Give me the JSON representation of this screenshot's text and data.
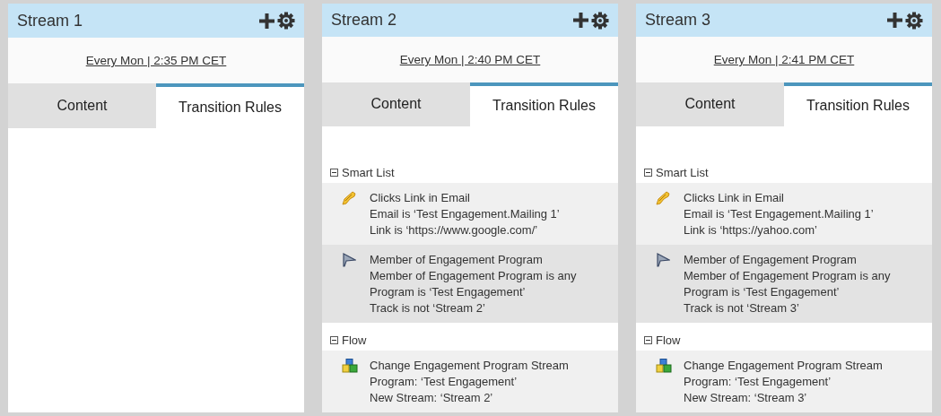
{
  "streams": [
    {
      "title": "Stream 1",
      "schedule": "Every Mon | 2:35 PM CET",
      "tabs": [
        {
          "label": "Content",
          "selected": false
        },
        {
          "label": "Transition Rules",
          "selected": true
        }
      ]
    },
    {
      "title": "Stream 2",
      "schedule": "Every Mon | 2:40 PM CET",
      "tabs": [
        {
          "label": "Content",
          "selected": false
        },
        {
          "label": "Transition Rules",
          "selected": true
        }
      ],
      "sections": [
        {
          "title": "Smart List",
          "expanded": true,
          "items": [
            {
              "kind": "click",
              "selected": false,
              "lines": [
                "Clicks Link in Email",
                "Email is ‘Test Engagement.Mailing 1’",
                "Link is ‘https://www.google.com/’"
              ]
            },
            {
              "kind": "member",
              "selected": true,
              "lines": [
                "Member of Engagement Program",
                "Member of Engagement Program is any",
                "Program is ‘Test Engagement’",
                "Track is not ‘Stream 2’"
              ]
            }
          ]
        },
        {
          "title": "Flow",
          "expanded": true,
          "items": [
            {
              "kind": "change",
              "selected": false,
              "lines": [
                "Change Engagement Program Stream",
                "Program: ‘Test Engagement’",
                "New Stream: ‘Stream 2’"
              ]
            }
          ]
        }
      ]
    },
    {
      "title": "Stream 3",
      "schedule": "Every Mon | 2:41 PM CET",
      "tabs": [
        {
          "label": "Content",
          "selected": false
        },
        {
          "label": "Transition Rules",
          "selected": true
        }
      ],
      "sections": [
        {
          "title": "Smart List",
          "expanded": true,
          "items": [
            {
              "kind": "click",
              "selected": false,
              "lines": [
                "Clicks Link in Email",
                "Email is ‘Test Engagement.Mailing 1’",
                "Link is ‘https://yahoo.com’"
              ]
            },
            {
              "kind": "member",
              "selected": true,
              "lines": [
                "Member of Engagement Program",
                "Member of Engagement Program is any",
                "Program is ‘Test Engagement’",
                "Track is not ‘Stream 3’"
              ]
            }
          ]
        },
        {
          "title": "Flow",
          "expanded": true,
          "items": [
            {
              "kind": "change",
              "selected": false,
              "lines": [
                "Change Engagement Program Stream",
                "Program: ‘Test Engagement’",
                "New Stream: ‘Stream 3’"
              ]
            }
          ]
        }
      ]
    }
  ]
}
